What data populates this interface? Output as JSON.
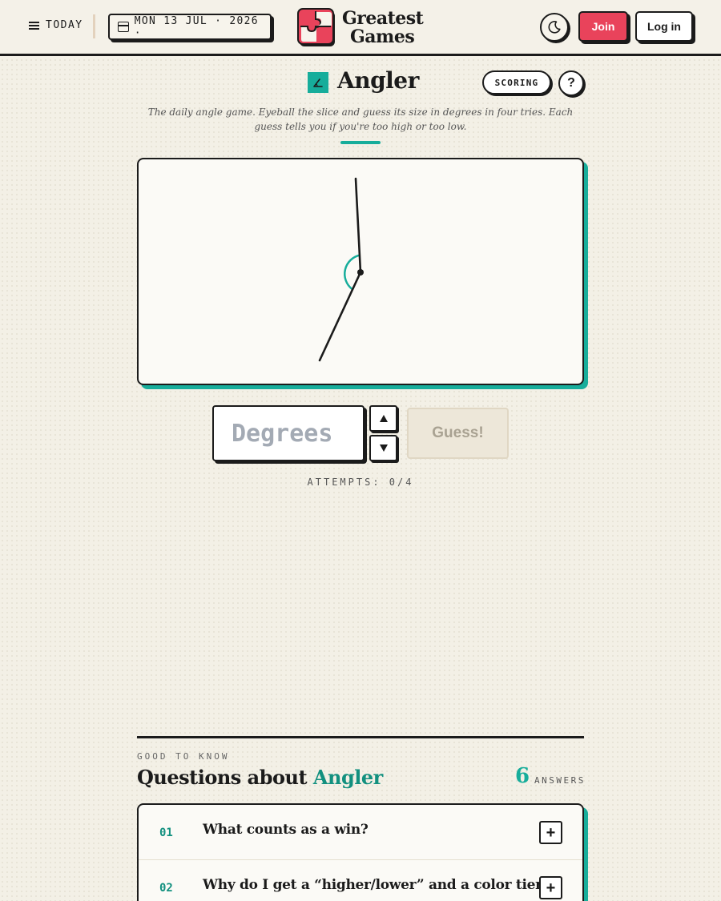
{
  "header": {
    "today_label": "TODAY",
    "date_label": "MON 13 JUL · 2026 ·",
    "brand_line1": "Greatest",
    "brand_line2": "Games",
    "join_label": "Join",
    "login_label": "Log in",
    "icons": {
      "menu": "hamburger-icon",
      "calendar": "calendar-icon",
      "theme": "moon-icon",
      "logo": "puzzle-logo"
    }
  },
  "game": {
    "title": "Angler",
    "icon": "angle-icon",
    "scoring_label": "SCORING",
    "help_label": "?",
    "tagline": "The daily angle game. Eyeball the slice and guess its size in degrees in four tries. Each guess tells you if you're too high or too low.",
    "input_placeholder": "Degrees",
    "guess_label": "Guess!",
    "attempts_label": "ATTEMPTS: 0/4"
  },
  "faq": {
    "eyebrow": "GOOD TO KNOW",
    "title_prefix": "Questions about",
    "title_accent": "Angler",
    "count": "6",
    "count_label": "ANSWERS",
    "items": [
      {
        "num": "01",
        "question": "What counts as a win?"
      },
      {
        "num": "02",
        "question": "Why do I get a “higher/lower” and a color tier?"
      }
    ]
  },
  "colors": {
    "background": "#f3f0e6",
    "accent_teal": "#17ad9b",
    "join_red": "#e9435b",
    "ink": "#1b1b1b"
  }
}
